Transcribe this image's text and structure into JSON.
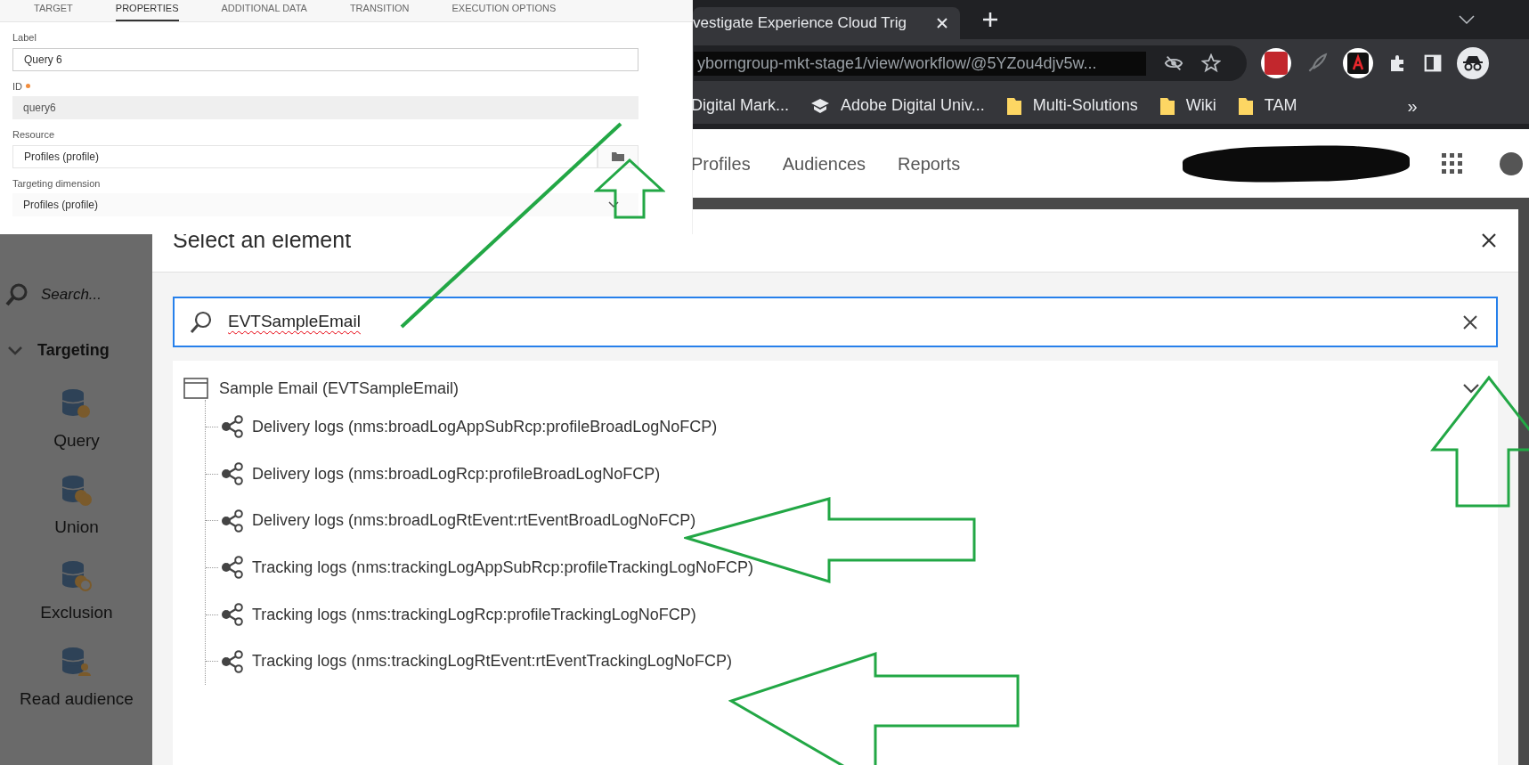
{
  "browser": {
    "tab_title": "vestigate Experience Cloud Trig",
    "address": "yborngroup-mkt-stage1/view/workflow/@5YZou4djv5w...",
    "bookmarks": [
      {
        "label": "Digital Mark...",
        "kind": "page"
      },
      {
        "label": "Adobe Digital Univ...",
        "kind": "cap"
      },
      {
        "label": "Multi-Solutions",
        "kind": "folder"
      },
      {
        "label": "Wiki",
        "kind": "folder"
      },
      {
        "label": "TAM",
        "kind": "folder"
      }
    ],
    "bookmarks_overflow": "»"
  },
  "app_nav": [
    "Profiles",
    "Audiences",
    "Reports"
  ],
  "sidebar": {
    "search_placeholder": "Search...",
    "group": {
      "label": "Targeting",
      "expanded": true,
      "items": [
        {
          "label": "Query",
          "kind": "query"
        },
        {
          "label": "Union",
          "kind": "union"
        },
        {
          "label": "Exclusion",
          "kind": "exclusion"
        },
        {
          "label": "Read audience",
          "kind": "audience"
        }
      ]
    }
  },
  "dialog": {
    "title": "Select an element",
    "search_value": "EVTSampleEmail",
    "tree": {
      "label": "Sample Email (EVTSampleEmail)",
      "expanded": true,
      "children": [
        {
          "label": "Delivery logs (nms:broadLogAppSubRcp:profileBroadLogNoFCP)"
        },
        {
          "label": "Delivery logs (nms:broadLogRcp:profileBroadLogNoFCP)"
        },
        {
          "label": "Delivery logs (nms:broadLogRtEvent:rtEventBroadLogNoFCP)"
        },
        {
          "label": "Tracking logs (nms:trackingLogAppSubRcp:profileTrackingLogNoFCP)"
        },
        {
          "label": "Tracking logs (nms:trackingLogRcp:profileTrackingLogNoFCP)"
        },
        {
          "label": "Tracking logs (nms:trackingLogRtEvent:rtEventTrackingLogNoFCP)"
        }
      ]
    }
  },
  "properties_panel": {
    "tabs": [
      {
        "label": "TARGET",
        "selected": false
      },
      {
        "label": "PROPERTIES",
        "selected": true
      },
      {
        "label": "ADDITIONAL DATA",
        "selected": false
      },
      {
        "label": "TRANSITION",
        "selected": false
      },
      {
        "label": "EXECUTION OPTIONS",
        "selected": false
      }
    ],
    "fields": [
      {
        "label": "Label",
        "value": "Query 6",
        "kind": "text"
      },
      {
        "label": "ID",
        "value": "query6",
        "kind": "readonly",
        "required": true
      },
      {
        "label": "Resource",
        "value": "Profiles (profile)",
        "kind": "picker"
      },
      {
        "label": "Targeting dimension",
        "value": "Profiles (profile)",
        "kind": "select"
      }
    ]
  }
}
